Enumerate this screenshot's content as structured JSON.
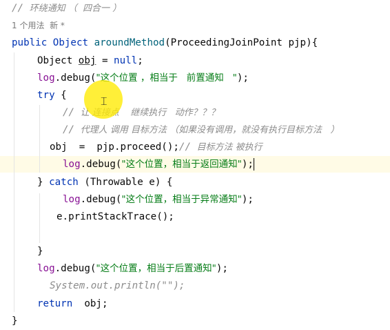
{
  "editor": {
    "line_highlight_color": "#fffbe6",
    "cursor_halo_color": "#ffeb00",
    "comment_title": {
      "slashes": "// ",
      "text": "环绕通知 （  四合一 ）"
    },
    "usage_hint": "1 个用法  新 *",
    "signature": {
      "modifiers": "public Object ",
      "method": "aroundMethod",
      "params": "(ProceedingJoinPoint pjp){"
    },
    "decl": {
      "type": "Object ",
      "var": "obj",
      "rest": " = ",
      "null_kw": "null",
      "semi": ";"
    },
    "log1": {
      "field": "log",
      "call": ".debug(",
      "string": "\"这个位置 ，相当于   前置通知   \"",
      "end": ");"
    },
    "try_line": {
      "kw": "try",
      "rest": " {"
    },
    "comment1": {
      "slashes": "// ",
      "text": "让 连接点    继续执行   动作？？？"
    },
    "comment2": {
      "slashes": "// ",
      "text": "代理人 调用 目标方法 （如果没有调用，就没有执行目标方法   ）"
    },
    "proceed_line": {
      "var": "obj",
      "code": "  =  pjp.proceed();",
      "comment_slashes": "// ",
      "comment_text": "目标方法 被执行"
    },
    "log2": {
      "field": "log",
      "call": ".debug(",
      "string": "\"这个位置，相当于返回通知\"",
      "end": ");"
    },
    "catch_line": {
      "brace": "} ",
      "kw": "catch",
      "rest": " (Throwable e) {"
    },
    "log3": {
      "field": "log",
      "call": ".debug(",
      "string": "\"这个位置，相当于异常通知\"",
      "end": ");"
    },
    "print_stack": "e.printStackTrace();",
    "close_try": "}",
    "log4": {
      "field": "log",
      "call": ".debug(",
      "string": "\"这个位置，相当于后置通知\"",
      "end": ");"
    },
    "sysout": "System.out.println(\"\");",
    "return_line": {
      "kw": "return",
      "rest": "  obj;"
    },
    "close_method": "}"
  }
}
